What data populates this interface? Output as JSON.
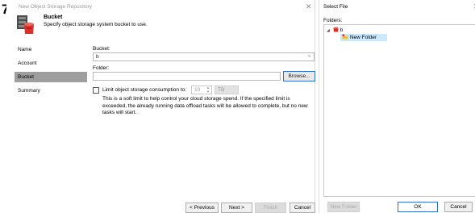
{
  "step_number": "7",
  "wizard": {
    "window_title": "New Object Storage Repository",
    "heading": "Bucket",
    "description": "Specify object storage system bucket to use.",
    "nav_items": [
      "Name",
      "Account",
      "Bucket",
      "Summary"
    ],
    "active_nav_index": 2,
    "form": {
      "bucket_label": "Bucket:",
      "bucket_value": "b",
      "folder_label": "Folder:",
      "folder_value": "",
      "browse_label": "Browse...",
      "limit_label": "Limit object storage consumption to:",
      "limit_checked": false,
      "limit_value": "10",
      "limit_unit": "TB",
      "note": "This is a soft limit to help control your cloud storage spend. If the specified limit is exceeded, the already running data offload tasks will be allowed to complete, but no new tasks will start."
    },
    "buttons": {
      "previous": "< Previous",
      "next": "Next >",
      "finish": "Finish",
      "cancel": "Cancel"
    },
    "icons": {
      "repository": "object-storage-icon",
      "close": "close-icon"
    }
  },
  "select_file": {
    "title": "Select File",
    "folders_label": "Folders:",
    "tree": [
      {
        "label": "b",
        "level": 0,
        "expanded": true,
        "icon": "bucket-icon"
      },
      {
        "label": "New Folder",
        "level": 1,
        "selected": true,
        "icon": "new-folder-icon"
      }
    ],
    "buttons": {
      "new_folder": "New Folder",
      "ok": "OK",
      "cancel": "Cancel"
    }
  },
  "colors": {
    "accent": "#2d6fd6",
    "bucket_red": "#d9302c",
    "nav_active": "#9e9e9e",
    "tree_selected": "#cce8ff",
    "folder_yellow": "#f2c230"
  }
}
